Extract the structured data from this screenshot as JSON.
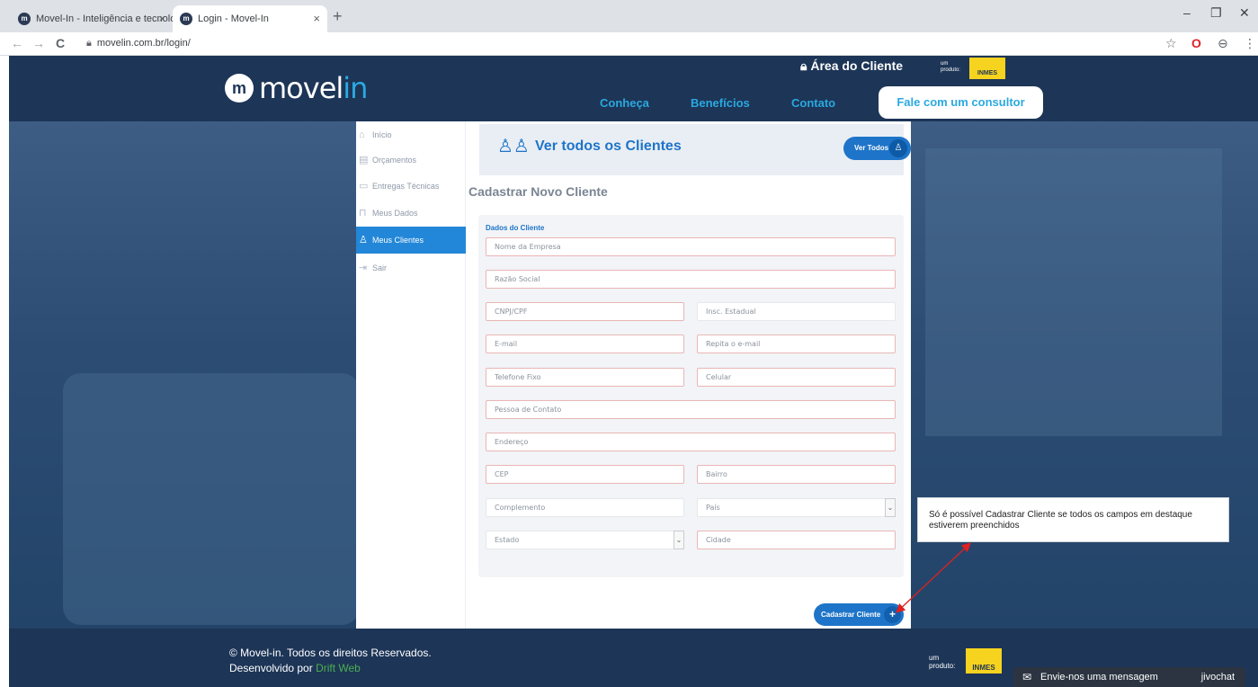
{
  "browser": {
    "tabs": [
      {
        "title": "Movel-In - Inteligência e tecnolo",
        "close": "×"
      },
      {
        "title": "Login - Movel-In",
        "close": "×"
      }
    ],
    "new_tab": "+",
    "window_controls": [
      "–",
      "❐",
      "✕"
    ],
    "nav": {
      "back": "←",
      "forward": "→",
      "reload": "C"
    },
    "url": "movelin.com.br/login/",
    "address_icons": [
      "☆",
      "O",
      "⊖",
      "⋮"
    ]
  },
  "header": {
    "logo_main": "movel",
    "logo_accent": "in",
    "logo_mark": "m",
    "area_cliente": "Área do Cliente",
    "um_produto": "um produto:",
    "inmes": "INMES",
    "nav": [
      "Conheça",
      "Benefícios",
      "Contato"
    ],
    "cta": "Fale com um consultor"
  },
  "sidebar": {
    "items": [
      {
        "label": "Início",
        "icon": "⌂"
      },
      {
        "label": "Orçamentos",
        "icon": "▤"
      },
      {
        "label": "Entregas Técnicas",
        "icon": "▭"
      },
      {
        "label": "Meus Dados",
        "icon": "⊓"
      },
      {
        "label": "Meus Clientes",
        "icon": "♙"
      },
      {
        "label": "Sair",
        "icon": "⇥"
      }
    ]
  },
  "main": {
    "banner_title": "Ver todos os Clientes",
    "banner_icon": "♙♙",
    "ver_todos": "Ver Todos",
    "page_title": "Cadastrar Novo Cliente",
    "form_legend": "Dados do Cliente",
    "fields": {
      "empresa": "Nome da Empresa",
      "razao": "Razão Social",
      "cnpj": "CNPJ/CPF",
      "insc": "Insc. Estadual",
      "email": "E-mail",
      "email2": "Repita o e-mail",
      "telefone": "Telefone Fixo",
      "celular": "Celular",
      "contato": "Pessoa de Contato",
      "endereco": "Endereço",
      "cep": "CEP",
      "bairro": "Bairro",
      "complemento": "Complemento",
      "pais": "País",
      "estado": "Estado",
      "cidade": "Cidade"
    },
    "submit": "Cadastrar Cliente",
    "submit_icon": "+"
  },
  "tooltip": "Só é possível Cadastrar Cliente se todos os campos em destaque estiverem preenchidos",
  "footer": {
    "copyright": "© Movel-in. Todos os direitos Reservados.",
    "dev_prefix": "Desenvolvido por ",
    "dev_name": "Drift Web",
    "um_produto": "um produto:",
    "inmes": "INMES"
  },
  "chat": {
    "icon": "✉",
    "label": "Envie-nos uma mensagem",
    "brand": "jivochat"
  },
  "colors": {
    "header_bg": "#1d3557",
    "accent_blue": "#1e74c8",
    "link_blue": "#2aa9e0",
    "highlight_border": "#e9b6b6",
    "arrow_red": "#e02020"
  }
}
